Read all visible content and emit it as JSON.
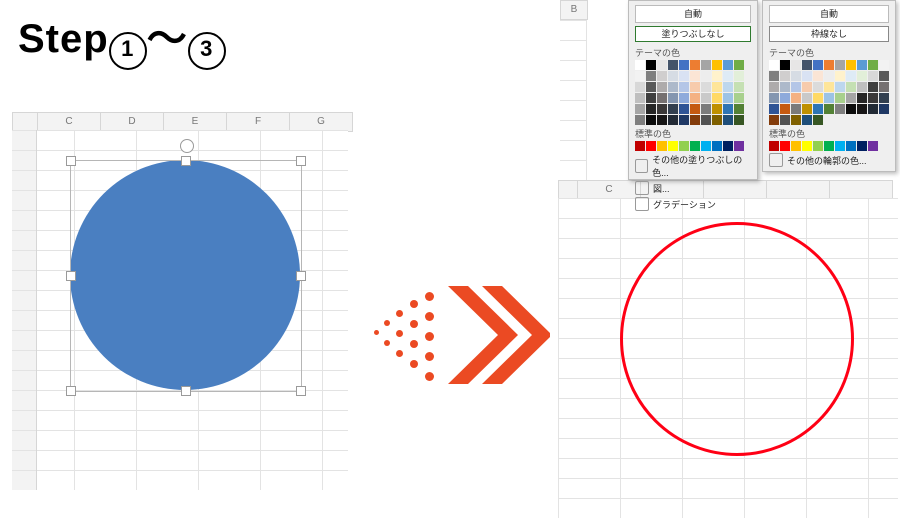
{
  "title_prefix": "Step",
  "title_n1": "1",
  "title_sep": "〜",
  "title_n3": "3",
  "left_sheet": {
    "columns": [
      "",
      "C",
      "D",
      "E",
      "F",
      "G"
    ]
  },
  "right_sheet": {
    "columns": [
      "",
      "C"
    ]
  },
  "right_colB": "B",
  "shape_left": {
    "fill": "#4a7fc1"
  },
  "shape_right": {
    "stroke": "#ff0015"
  },
  "arrow_color": "#eb4a23",
  "dd_fill": {
    "auto": "自動",
    "option": "塗りつぶしなし",
    "section1": "テーマの色",
    "section2": "標準の色",
    "more": "その他の塗りつぶしの色...",
    "picture": "図...",
    "gradient": "グラデーション"
  },
  "dd_line": {
    "auto": "自動",
    "option": "枠線なし",
    "section1": "テーマの色",
    "section2": "標準の色",
    "more": "その他の輪郭の色..."
  },
  "theme_colors": [
    "#ffffff",
    "#000000",
    "#e7e6e6",
    "#44546a",
    "#4472c4",
    "#ed7d31",
    "#a5a5a5",
    "#ffc000",
    "#5b9bd5",
    "#70ad47"
  ],
  "theme_tints": [
    [
      "#f2f2f2",
      "#7f7f7f",
      "#d0cece",
      "#d6dce4",
      "#d9e2f3",
      "#fbe5d5",
      "#ededed",
      "#fff2cc",
      "#deebf6",
      "#e2efd9"
    ],
    [
      "#d8d8d8",
      "#595959",
      "#aeabab",
      "#adb9ca",
      "#b4c6e7",
      "#f7cbac",
      "#dbdbdb",
      "#fee599",
      "#bdd7ee",
      "#c5e0b3"
    ],
    [
      "#bfbfbf",
      "#3f3f3f",
      "#757070",
      "#8496b0",
      "#8eaadb",
      "#f4b183",
      "#c9c9c9",
      "#ffd965",
      "#9cc3e5",
      "#a8d08d"
    ],
    [
      "#a5a5a5",
      "#262626",
      "#3a3838",
      "#323f4f",
      "#2f5496",
      "#c55a11",
      "#7b7b7b",
      "#bf9000",
      "#2e75b5",
      "#538135"
    ],
    [
      "#7f7f7f",
      "#0c0c0c",
      "#171616",
      "#222a35",
      "#1f3864",
      "#833c0b",
      "#525252",
      "#7f6000",
      "#1e4e79",
      "#375623"
    ]
  ],
  "standard_colors": [
    "#c00000",
    "#ff0000",
    "#ffc000",
    "#ffff00",
    "#92d050",
    "#00b050",
    "#00b0f0",
    "#0070c0",
    "#002060",
    "#7030a0"
  ]
}
